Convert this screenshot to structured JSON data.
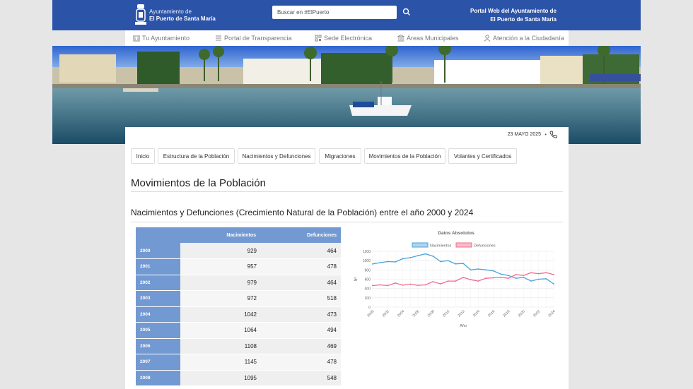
{
  "header": {
    "brand_line1": "Ayuntamiento de",
    "brand_line2": "El Puerto de Santa María",
    "search_placeholder": "Buscar en #ElPuerto",
    "portal_line1": "Portal Web del Ayuntamiento de",
    "portal_line2": "El Puerto de Santa María",
    "bar_color": "#2b53a8"
  },
  "nav": {
    "items": [
      {
        "label": "Tu Ayuntamiento",
        "icon": "building-icon"
      },
      {
        "label": "Portal de Transparencia",
        "icon": "list-icon"
      },
      {
        "label": "Sede Electrónica",
        "icon": "qr-icon"
      },
      {
        "label": "Áreas Municipales",
        "icon": "bank-icon"
      },
      {
        "label": "Atención a la Ciudadanía",
        "icon": "person-icon"
      }
    ]
  },
  "datebar": {
    "date": "23 MAYO 2025",
    "separator": "•"
  },
  "tabs": [
    "Inicio",
    "Estructura de la Población",
    "Nacimientos y Defunciones",
    "Migraciones",
    "Movimientos de la Población",
    "Volantes y Certificados"
  ],
  "page_title": "Movimientos de la Población",
  "section_title": "Nacimientos y Defunciones (Crecimiento Natural de la Población) entre el año 2000 y 2024",
  "table": {
    "headers": [
      "",
      "Nacimientos",
      "Defunciones"
    ],
    "rows": [
      [
        "2000",
        "929",
        "464"
      ],
      [
        "2001",
        "957",
        "478"
      ],
      [
        "2002",
        "979",
        "464"
      ],
      [
        "2003",
        "972",
        "518"
      ],
      [
        "2004",
        "1042",
        "473"
      ],
      [
        "2005",
        "1064",
        "494"
      ],
      [
        "2006",
        "1108",
        "469"
      ],
      [
        "2007",
        "1145",
        "478"
      ],
      [
        "2008",
        "1095",
        "548"
      ]
    ]
  },
  "chart_data": {
    "type": "line",
    "title": "Datos Absolutos",
    "xlabel": "Año",
    "ylabel": "Nº",
    "ylim": [
      0,
      1200
    ],
    "yticks": [
      0,
      200,
      400,
      600,
      800,
      1000,
      1200
    ],
    "xticklabels": [
      "2000",
      "2002",
      "2004",
      "2006",
      "2008",
      "2010",
      "2012",
      "2014",
      "2016",
      "2018",
      "2020",
      "2022",
      "2024"
    ],
    "x": [
      2000,
      2001,
      2002,
      2003,
      2004,
      2005,
      2006,
      2007,
      2008,
      2009,
      2010,
      2011,
      2012,
      2013,
      2014,
      2015,
      2016,
      2017,
      2018,
      2019,
      2020,
      2021,
      2022,
      2023,
      2024
    ],
    "legend_position": "top",
    "grid": true,
    "series": [
      {
        "name": "Nacimientos",
        "color": "#4aa3d9",
        "values": [
          929,
          957,
          979,
          972,
          1042,
          1064,
          1108,
          1145,
          1095,
          980,
          1000,
          930,
          940,
          800,
          820,
          800,
          780,
          710,
          680,
          620,
          640,
          560,
          600,
          610,
          500
        ]
      },
      {
        "name": "Defunciones",
        "color": "#f06b8f",
        "values": [
          464,
          478,
          464,
          518,
          473,
          494,
          469,
          478,
          548,
          500,
          560,
          560,
          640,
          590,
          560,
          620,
          630,
          640,
          620,
          700,
          680,
          740,
          720,
          740,
          700
        ]
      }
    ]
  }
}
